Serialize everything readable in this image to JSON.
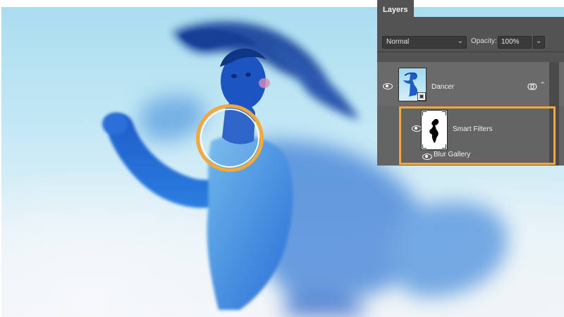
{
  "layers_panel": {
    "tab_label": "Layers",
    "blend_mode": "Normal",
    "opacity_label": "Opacity:",
    "opacity_value": "100%",
    "layers": [
      {
        "name": "Dancer",
        "visible": true,
        "type": "smart-object"
      },
      {
        "name": "Smart Filters",
        "visible": true,
        "type": "smart-filter-mask"
      },
      {
        "name": "Blur Gallery",
        "visible": true,
        "type": "filter"
      }
    ]
  },
  "icons": {
    "eye": "eye-icon",
    "link": "link-icon",
    "collapse": "chevron-up-icon",
    "dropdown": "chevron-down-icon"
  },
  "colors": {
    "highlight": "#f0a93a",
    "panel_bg": "#535353",
    "selected_layer": "#6a6a6a"
  }
}
